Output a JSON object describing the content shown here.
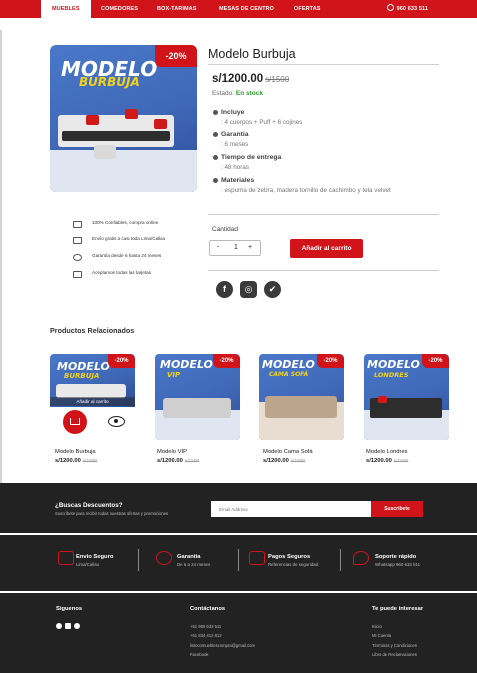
{
  "nav": {
    "items": [
      "MUEBLES",
      "COMEDORES",
      "BOX-TARIMAS",
      "MESAS DE CENTRO",
      "OFERTAS"
    ],
    "phone": "960 633 511"
  },
  "colors": {
    "brand": "#d0141a",
    "in_stock": "#2e9a33",
    "footer_bg": "#222222"
  },
  "product": {
    "image_text_1": "MODELO",
    "image_text_2": "BURBUJA",
    "discount": "-20%",
    "title": "Modelo Burbuja",
    "price": "s/1200.00",
    "old_price": "s/1500",
    "status_label": "Estado:",
    "status_value": "En stock",
    "specs": [
      {
        "label": "Incluye",
        "value": ": 4 cuerpos + Puff + 6 cojines"
      },
      {
        "label": "Garantia",
        "value": ": 6 meses"
      },
      {
        "label": "Tiempo de entrega",
        "value": ": 48 horas"
      },
      {
        "label": "Materiales",
        "value": ": espuma de zebra, madera tornillo de cachimbo y tela velvet"
      }
    ],
    "qty_label": "Cantidad",
    "qty_minus": "-",
    "qty_value": "1",
    "qty_plus": "+",
    "add_to_cart": "Añadir al carrito"
  },
  "perks": [
    {
      "icon": "thumbs-up-icon",
      "text": "100% Confiables, compra online"
    },
    {
      "icon": "truck-icon",
      "text": "Envío gratis a casi toda Lima/Callao"
    },
    {
      "icon": "shield-icon",
      "text": "Garantía desde 6 hasta 24 meses"
    },
    {
      "icon": "card-icon",
      "text": "Aceptamos todas las tarjetas"
    }
  ],
  "related": {
    "title": "Productos Relacionados",
    "hover_label": "Añadir al carrito",
    "items": [
      {
        "name": "Modelo Burbuja",
        "price": "s/1200.00",
        "old": "s/1500",
        "badge": "-20%",
        "img_1": "MODELO",
        "img_2": "BURBUJA"
      },
      {
        "name": "Modelo VIP",
        "price": "s/1200.00",
        "old": "s/1500",
        "badge": "-20%",
        "img_1": "MODELO",
        "img_2": "VIP"
      },
      {
        "name": "Modelo Cama Sofá",
        "price": "s/1200.00",
        "old": "s/1500",
        "badge": "-20%",
        "img_1": "MODELO",
        "img_2": "CAMA SOFÁ"
      },
      {
        "name": "Modelo Londres",
        "price": "s/1200.00",
        "old": "s/1500",
        "badge": "-20%",
        "img_1": "MODELO",
        "img_2": "LONDRES"
      }
    ]
  },
  "newsletter": {
    "title": "¿Buscas Descuentos?",
    "subtitle": "Suscríbete para recibir todas nuestras ofertas y promociones",
    "placeholder": "Email Address",
    "button": "Suscribete"
  },
  "benefits": [
    {
      "icon": "truck-icon",
      "title": "Envio Seguro",
      "sub": "Lima/Callao"
    },
    {
      "icon": "refresh-icon",
      "title": "Garantia",
      "sub": "De 6 a 24 meses"
    },
    {
      "icon": "card-icon",
      "title": "Pagos Seguros",
      "sub": "Referencias de seguridad"
    },
    {
      "icon": "chat-icon",
      "title": "Soporte rápido",
      "sub": "Whatsapp 960 633 511"
    }
  ],
  "footer": {
    "follow_title": "Siguenos",
    "contact_title": "Contáctanos",
    "contact_lines": [
      "+51 960 633 511",
      "+51 834 412 812",
      "listocomueblescompra@gmail.com",
      "Facebook"
    ],
    "links_title": "Te puede interesar",
    "links": [
      "Inicio",
      "Mi Cuenta",
      "Términos y Condiciones",
      "Libro de Reclamaciones"
    ]
  }
}
